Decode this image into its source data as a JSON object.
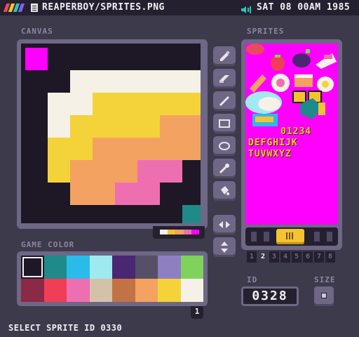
{
  "topbar": {
    "logo_colors": [
      "#e84a5f",
      "#f4c430",
      "#2ec4b6",
      "#8a5cf6"
    ],
    "file_name": "REAPERBOY/SPRITES.PNG",
    "clock": "SAT 08 00AM 1985"
  },
  "canvas": {
    "label": "CANVAS",
    "mini_palette": [
      "#f2f0f4",
      "#f4c430",
      "#f4a261",
      "#ee6fb0",
      "#ff00ff"
    ]
  },
  "tools": {
    "items": [
      "pencil",
      "eraser",
      "line",
      "rectangle",
      "ellipse",
      "eyedropper",
      "fill"
    ],
    "flip_horizontal": "flip-horizontal",
    "flip_vertical": "flip-vertical"
  },
  "game_color": {
    "label": "GAME COLOR",
    "colors": [
      "#1e1826",
      "#1f8a8a",
      "#2bbbe8",
      "#9eeaf0",
      "#4a2773",
      "#555067",
      "#8e7fc2",
      "#7fd35a",
      "#8a2a46",
      "#ef3e56",
      "#ee6fb0",
      "#d4c2a8",
      "#c27346",
      "#f4a261",
      "#f4d33a",
      "#f5f1e6"
    ],
    "selected_index": 0,
    "page": "1"
  },
  "sprites": {
    "label": "SPRITES",
    "letter_rows": [
      "01234",
      "DEFGHIJK",
      "TUVWXYZ"
    ],
    "banks": [
      "1",
      "2",
      "3",
      "4",
      "5",
      "6",
      "7",
      "8"
    ],
    "active_bank": 1
  },
  "id": {
    "label": "ID",
    "value": "0328"
  },
  "size": {
    "label": "SIZE"
  },
  "status": "SELECT SPRITE ID 0330"
}
